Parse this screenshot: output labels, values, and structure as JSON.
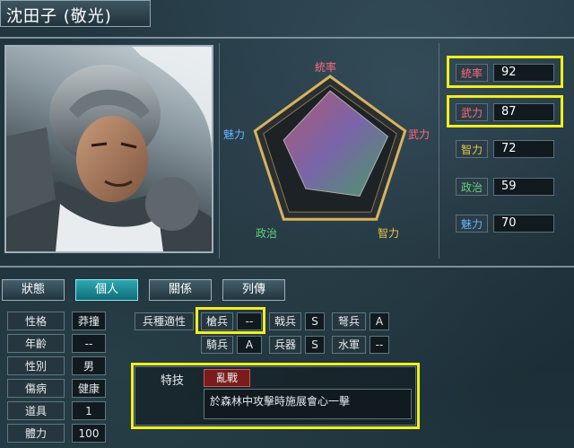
{
  "header": {
    "title": "沈田子 (敬光)"
  },
  "radar": {
    "labels": {
      "top": "統率",
      "right": "武力",
      "bottom_right": "智力",
      "bottom_left": "政治",
      "left": "魅力"
    },
    "values": [
      92,
      87,
      72,
      59,
      70
    ]
  },
  "stats": [
    {
      "name": "統率",
      "value": "92",
      "highlighted": true
    },
    {
      "name": "武力",
      "value": "87",
      "highlighted": true
    },
    {
      "name": "智力",
      "value": "72",
      "highlighted": false
    },
    {
      "name": "政治",
      "value": "59",
      "highlighted": false
    },
    {
      "name": "魅力",
      "value": "70",
      "highlighted": false
    }
  ],
  "stat_colors": {
    "統率": "#ff6a7d",
    "武力": "#ff6a7d",
    "智力": "#e7c64a",
    "政治": "#63d07b",
    "魅力": "#6ab3ff"
  },
  "tabs": [
    {
      "label": "狀態",
      "active": false
    },
    {
      "label": "個人",
      "active": true
    },
    {
      "label": "關係",
      "active": false
    },
    {
      "label": "列傳",
      "active": false
    }
  ],
  "attributes": [
    {
      "name": "性格",
      "value": "莽撞"
    },
    {
      "name": "年齡",
      "value": "--"
    },
    {
      "name": "性別",
      "value": "男"
    },
    {
      "name": "傷病",
      "value": "健康"
    },
    {
      "name": "道具",
      "value": "1"
    },
    {
      "name": "體力",
      "value": "100"
    }
  ],
  "aptitude": {
    "label": "兵種適性",
    "rows": [
      [
        {
          "name": "槍兵",
          "value": "--"
        },
        {
          "name": "戟兵",
          "value": "S"
        },
        {
          "name": "弩兵",
          "value": "A"
        }
      ],
      [
        {
          "name": "騎兵",
          "value": "A"
        },
        {
          "name": "兵器",
          "value": "S"
        },
        {
          "name": "水軍",
          "value": "--"
        }
      ]
    ]
  },
  "skill": {
    "label": "特技",
    "name": "亂戰",
    "description": "於森林中攻擊時施展會心一擊"
  },
  "highlight_color": "#f2ee1e"
}
